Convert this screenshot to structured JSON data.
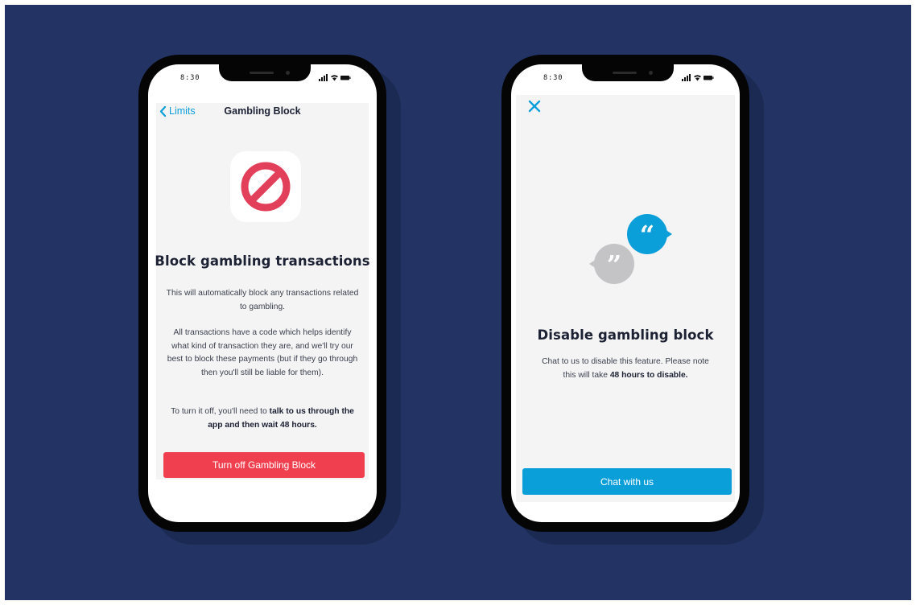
{
  "colors": {
    "background": "#233464",
    "accent_blue": "#0b9fd9",
    "accent_red": "#f0404f",
    "panel": "#f4f4f5"
  },
  "left_phone": {
    "status_time": "8:30",
    "nav": {
      "back_label": "Limits",
      "title": "Gambling Block"
    },
    "icon": "no-entry-icon",
    "heading": "Block gambling transactions",
    "paragraph_1": "This will automatically block any transactions related to gambling.",
    "paragraph_2": "All transactions have a code which helps identify what kind of transaction they are, and we'll try our best to block these payments (but if they go through then you'll still be liable for them).",
    "paragraph_3_plain": "To turn it off, you'll need to ",
    "paragraph_3_bold": "talk to us through the app and then wait 48 hours.",
    "button_label": "Turn off Gambling Block"
  },
  "right_phone": {
    "status_time": "8:30",
    "close_icon": "close-icon",
    "illustration": "chat-bubbles-icon",
    "heading": "Disable gambling block",
    "body_plain": "Chat to us to disable this feature. Please note this will take ",
    "body_bold": "48 hours to disable.",
    "button_label": "Chat with us"
  }
}
